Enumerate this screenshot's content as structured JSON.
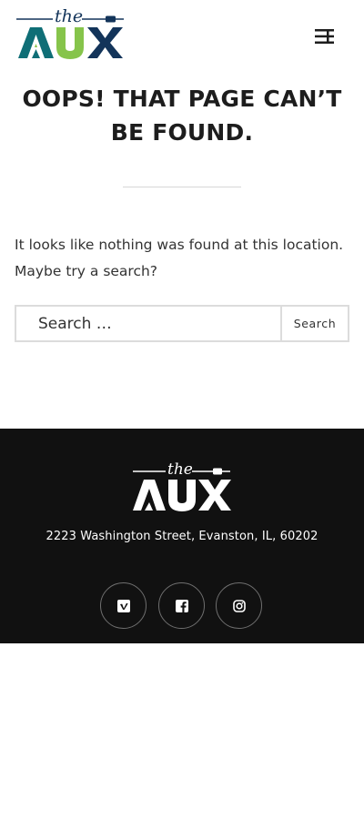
{
  "brand": {
    "logo_prefix": "the",
    "logo_name": "AUX",
    "colors": {
      "teal": "#0f6e76",
      "green": "#86c44b",
      "navy": "#13345a"
    }
  },
  "header": {
    "menu_icon": "sidebar-toggle-icon"
  },
  "main": {
    "title": "OOPS! THAT PAGE CAN’T BE FOUND.",
    "message": "It looks like nothing was found at this location. Maybe try a search?"
  },
  "search": {
    "placeholder": "Search …",
    "button_label": "Search"
  },
  "footer": {
    "address": "2223 Washington Street, Evanston, IL, 60202",
    "social": [
      {
        "name": "vimeo",
        "icon": "vimeo-icon"
      },
      {
        "name": "facebook",
        "icon": "facebook-icon"
      },
      {
        "name": "instagram",
        "icon": "instagram-icon"
      }
    ],
    "background": "#111111"
  }
}
